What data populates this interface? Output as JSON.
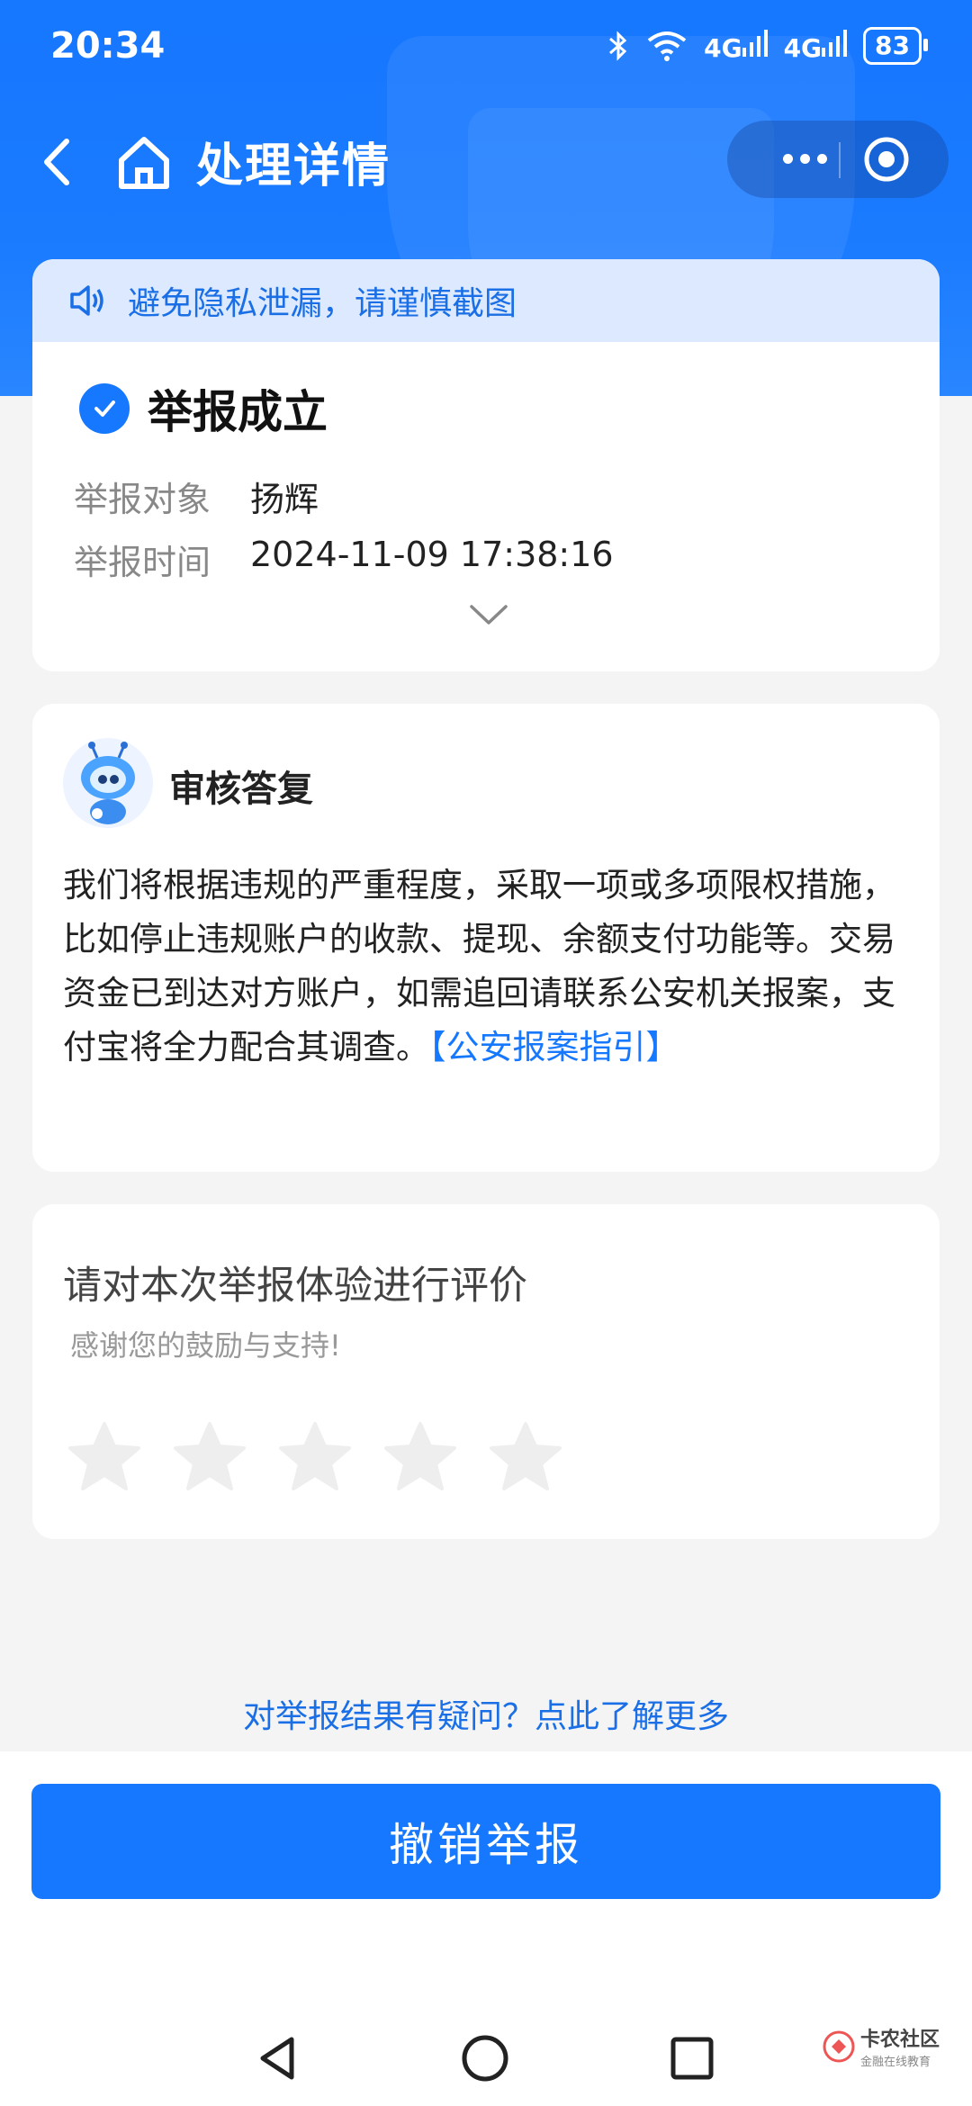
{
  "status_bar": {
    "time": "20:34",
    "signal1": "4G",
    "signal2": "4G",
    "battery": "83"
  },
  "nav": {
    "title": "处理详情"
  },
  "notice": {
    "text": "避免隐私泄漏，请谨慎截图"
  },
  "report": {
    "status": "举报成立",
    "target_label": "举报对象",
    "target_value": "扬辉",
    "time_label": "举报时间",
    "time_value": "2024-11-09 17:38:16"
  },
  "reply": {
    "title": "审核答复",
    "body": "我们将根据违规的严重程度，采取一项或多项限权措施，比如停止违规账户的收款、提现、余额支付功能等。交易资金已到达对方账户，如需追回请联系公安机关报案，支付宝将全力配合其调查。",
    "link": "【公安报案指引】"
  },
  "rating": {
    "title": "请对本次举报体验进行评价",
    "subtitle": "感谢您的鼓励与支持!",
    "stars_total": 5,
    "stars_selected": 0
  },
  "doubt_link": "对举报结果有疑问？点此了解更多",
  "revoke_button": "撤销举报",
  "watermark": {
    "name": "卡农社区",
    "sub": "金融在线教育"
  },
  "colors": {
    "primary": "#1677ff",
    "notice_bg": "#dce9ff",
    "star_empty": "#eeeeee"
  }
}
